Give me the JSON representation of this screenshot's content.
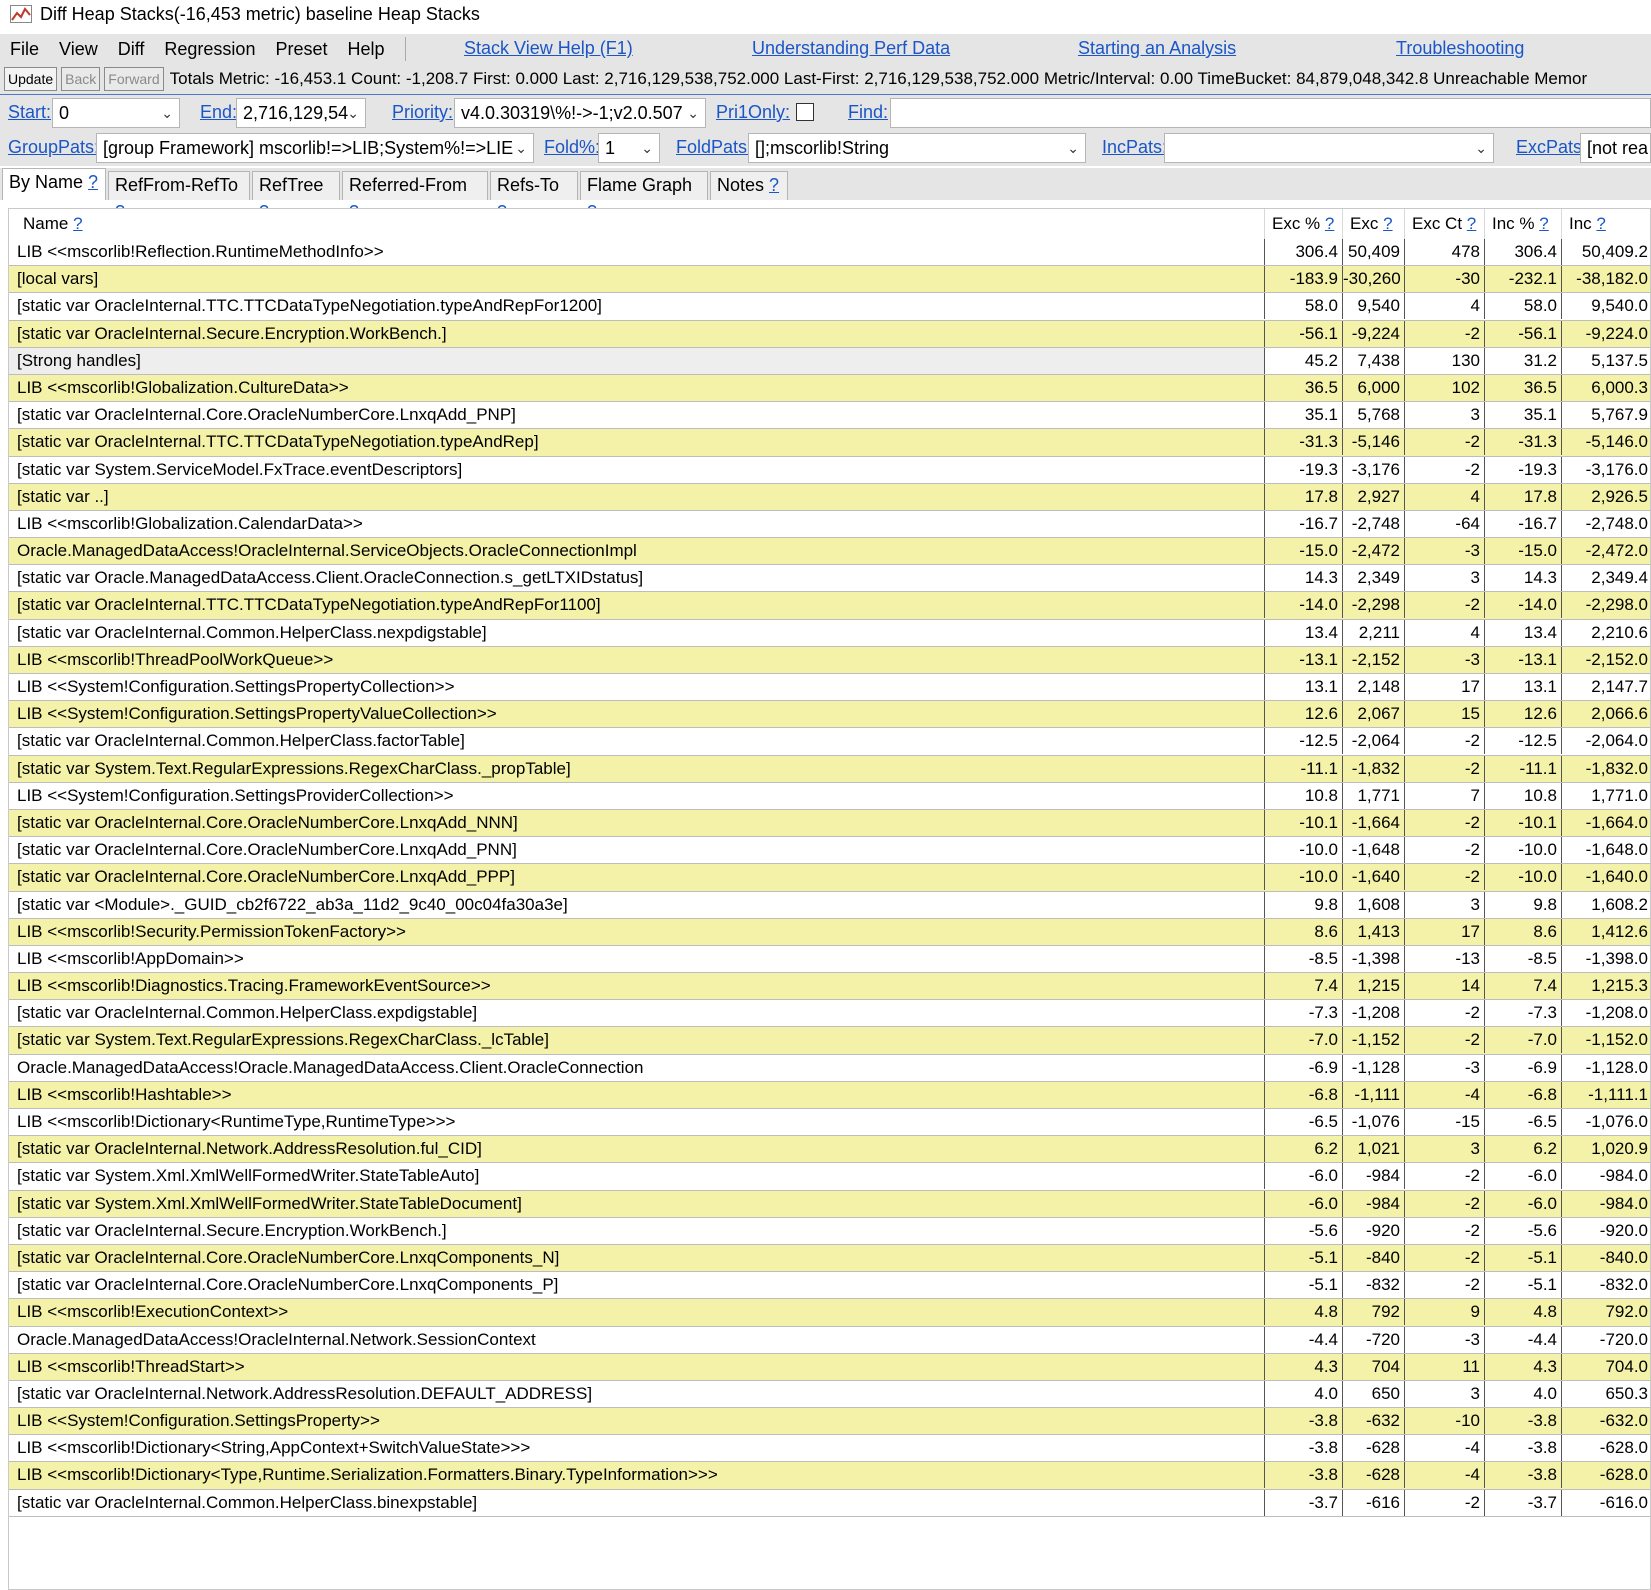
{
  "window": {
    "title": "Diff Heap Stacks(-16,453 metric) baseline Heap Stacks"
  },
  "menu": [
    "File",
    "View",
    "Diff",
    "Regression",
    "Preset",
    "Help"
  ],
  "help_links": [
    "Stack View Help (F1)",
    "Understanding Perf Data",
    "Starting an Analysis",
    "Troubleshooting"
  ],
  "toolbar": {
    "update_label": "Update",
    "back_label": "Back",
    "forward_label": "Forward",
    "totals_text": "Totals Metric: -16,453.1  Count: -1,208.7  First: 0.000 Last: 2,716,129,538,752.000  Last-First: 2,716,129,538,752.000  Metric/Interval: 0.00  TimeBucket: 84,879,048,342.8  Unreachable Memor"
  },
  "filters": {
    "start_label": "Start:",
    "start_value": "0",
    "end_label": "End:",
    "end_value": "2,716,129,54",
    "priority_label": "Priority:",
    "priority_value": "v4.0.30319\\%!->-1;v2.0.507",
    "pri1only_label": "Pri1Only:",
    "find_label": "Find:",
    "find_value": "",
    "grouppats_label": "GroupPats:",
    "grouppats_value": "[group Framework] mscorlib!=>LIB;System%!=>LIE",
    "fold_label": "Fold%:",
    "fold_value": "1",
    "foldpats_label": "FoldPats:",
    "foldpats_value": "[];mscorlib!String",
    "incpats_label": "IncPats:",
    "incpats_value": "",
    "excpats_label": "ExcPats:",
    "excpats_value": "[not rea"
  },
  "tabs": [
    "By Name",
    "RefFrom-RefTo",
    "RefTree",
    "Referred-From",
    "Refs-To",
    "Flame Graph",
    "Notes"
  ],
  "tab_help": "?",
  "columns": [
    "Name",
    "Exc %",
    "Exc",
    "Exc Ct",
    "Inc %",
    "Inc"
  ],
  "rows": [
    [
      "LIB <<mscorlib!Reflection.RuntimeMethodInfo>>",
      "306.4",
      "50,409",
      "478",
      "306.4",
      "50,409.2"
    ],
    [
      "[local vars]",
      "-183.9",
      "-30,260",
      "-30",
      "-232.1",
      "-38,182.0"
    ],
    [
      "[static var OracleInternal.TTC.TTCDataTypeNegotiation.typeAndRepFor1200]",
      "58.0",
      "9,540",
      "4",
      "58.0",
      "9,540.0"
    ],
    [
      "[static var OracleInternal.Secure.Encryption.WorkBench.]",
      "-56.1",
      "-9,224",
      "-2",
      "-56.1",
      "-9,224.0"
    ],
    [
      "[Strong handles]",
      "45.2",
      "7,438",
      "130",
      "31.2",
      "5,137.5"
    ],
    [
      "LIB <<mscorlib!Globalization.CultureData>>",
      "36.5",
      "6,000",
      "102",
      "36.5",
      "6,000.3"
    ],
    [
      "[static var OracleInternal.Core.OracleNumberCore.LnxqAdd_PNP]",
      "35.1",
      "5,768",
      "3",
      "35.1",
      "5,767.9"
    ],
    [
      "[static var OracleInternal.TTC.TTCDataTypeNegotiation.typeAndRep]",
      "-31.3",
      "-5,146",
      "-2",
      "-31.3",
      "-5,146.0"
    ],
    [
      "[static var System.ServiceModel.FxTrace.eventDescriptors]",
      "-19.3",
      "-3,176",
      "-2",
      "-19.3",
      "-3,176.0"
    ],
    [
      "[static var ..]",
      "17.8",
      "2,927",
      "4",
      "17.8",
      "2,926.5"
    ],
    [
      "LIB <<mscorlib!Globalization.CalendarData>>",
      "-16.7",
      "-2,748",
      "-64",
      "-16.7",
      "-2,748.0"
    ],
    [
      "Oracle.ManagedDataAccess!OracleInternal.ServiceObjects.OracleConnectionImpl",
      "-15.0",
      "-2,472",
      "-3",
      "-15.0",
      "-2,472.0"
    ],
    [
      "[static var Oracle.ManagedDataAccess.Client.OracleConnection.s_getLTXIDstatus]",
      "14.3",
      "2,349",
      "3",
      "14.3",
      "2,349.4"
    ],
    [
      "[static var OracleInternal.TTC.TTCDataTypeNegotiation.typeAndRepFor1100]",
      "-14.0",
      "-2,298",
      "-2",
      "-14.0",
      "-2,298.0"
    ],
    [
      "[static var OracleInternal.Common.HelperClass.nexpdigstable]",
      "13.4",
      "2,211",
      "4",
      "13.4",
      "2,210.6"
    ],
    [
      "LIB <<mscorlib!ThreadPoolWorkQueue>>",
      "-13.1",
      "-2,152",
      "-3",
      "-13.1",
      "-2,152.0"
    ],
    [
      "LIB <<System!Configuration.SettingsPropertyCollection>>",
      "13.1",
      "2,148",
      "17",
      "13.1",
      "2,147.7"
    ],
    [
      "LIB <<System!Configuration.SettingsPropertyValueCollection>>",
      "12.6",
      "2,067",
      "15",
      "12.6",
      "2,066.6"
    ],
    [
      "[static var OracleInternal.Common.HelperClass.factorTable]",
      "-12.5",
      "-2,064",
      "-2",
      "-12.5",
      "-2,064.0"
    ],
    [
      "[static var System.Text.RegularExpressions.RegexCharClass._propTable]",
      "-11.1",
      "-1,832",
      "-2",
      "-11.1",
      "-1,832.0"
    ],
    [
      "LIB <<System!Configuration.SettingsProviderCollection>>",
      "10.8",
      "1,771",
      "7",
      "10.8",
      "1,771.0"
    ],
    [
      "[static var OracleInternal.Core.OracleNumberCore.LnxqAdd_NNN]",
      "-10.1",
      "-1,664",
      "-2",
      "-10.1",
      "-1,664.0"
    ],
    [
      "[static var OracleInternal.Core.OracleNumberCore.LnxqAdd_PNN]",
      "-10.0",
      "-1,648",
      "-2",
      "-10.0",
      "-1,648.0"
    ],
    [
      "[static var OracleInternal.Core.OracleNumberCore.LnxqAdd_PPP]",
      "-10.0",
      "-1,640",
      "-2",
      "-10.0",
      "-1,640.0"
    ],
    [
      "[static var <Module>._GUID_cb2f6722_ab3a_11d2_9c40_00c04fa30a3e]",
      "9.8",
      "1,608",
      "3",
      "9.8",
      "1,608.2"
    ],
    [
      "LIB <<mscorlib!Security.PermissionTokenFactory>>",
      "8.6",
      "1,413",
      "17",
      "8.6",
      "1,412.6"
    ],
    [
      "LIB <<mscorlib!AppDomain>>",
      "-8.5",
      "-1,398",
      "-13",
      "-8.5",
      "-1,398.0"
    ],
    [
      "LIB <<mscorlib!Diagnostics.Tracing.FrameworkEventSource>>",
      "7.4",
      "1,215",
      "14",
      "7.4",
      "1,215.3"
    ],
    [
      "[static var OracleInternal.Common.HelperClass.expdigstable]",
      "-7.3",
      "-1,208",
      "-2",
      "-7.3",
      "-1,208.0"
    ],
    [
      "[static var System.Text.RegularExpressions.RegexCharClass._lcTable]",
      "-7.0",
      "-1,152",
      "-2",
      "-7.0",
      "-1,152.0"
    ],
    [
      "Oracle.ManagedDataAccess!Oracle.ManagedDataAccess.Client.OracleConnection",
      "-6.9",
      "-1,128",
      "-3",
      "-6.9",
      "-1,128.0"
    ],
    [
      "LIB <<mscorlib!Hashtable>>",
      "-6.8",
      "-1,111",
      "-4",
      "-6.8",
      "-1,111.1"
    ],
    [
      "LIB <<mscorlib!Dictionary<RuntimeType,RuntimeType>>>",
      "-6.5",
      "-1,076",
      "-15",
      "-6.5",
      "-1,076.0"
    ],
    [
      "[static var OracleInternal.Network.AddressResolution.ful_CID]",
      "6.2",
      "1,021",
      "3",
      "6.2",
      "1,020.9"
    ],
    [
      "[static var System.Xml.XmlWellFormedWriter.StateTableAuto]",
      "-6.0",
      "-984",
      "-2",
      "-6.0",
      "-984.0"
    ],
    [
      "[static var System.Xml.XmlWellFormedWriter.StateTableDocument]",
      "-6.0",
      "-984",
      "-2",
      "-6.0",
      "-984.0"
    ],
    [
      "[static var OracleInternal.Secure.Encryption.WorkBench.]",
      "-5.6",
      "-920",
      "-2",
      "-5.6",
      "-920.0"
    ],
    [
      "[static var OracleInternal.Core.OracleNumberCore.LnxqComponents_N]",
      "-5.1",
      "-840",
      "-2",
      "-5.1",
      "-840.0"
    ],
    [
      "[static var OracleInternal.Core.OracleNumberCore.LnxqComponents_P]",
      "-5.1",
      "-832",
      "-2",
      "-5.1",
      "-832.0"
    ],
    [
      "LIB <<mscorlib!ExecutionContext>>",
      "4.8",
      "792",
      "9",
      "4.8",
      "792.0"
    ],
    [
      "Oracle.ManagedDataAccess!OracleInternal.Network.SessionContext",
      "-4.4",
      "-720",
      "-3",
      "-4.4",
      "-720.0"
    ],
    [
      "LIB <<mscorlib!ThreadStart>>",
      "4.3",
      "704",
      "11",
      "4.3",
      "704.0"
    ],
    [
      "[static var OracleInternal.Network.AddressResolution.DEFAULT_ADDRESS]",
      "4.0",
      "650",
      "3",
      "4.0",
      "650.3"
    ],
    [
      "LIB <<System!Configuration.SettingsProperty>>",
      "-3.8",
      "-632",
      "-10",
      "-3.8",
      "-632.0"
    ],
    [
      "LIB <<mscorlib!Dictionary<String,AppContext+SwitchValueState>>>",
      "-3.8",
      "-628",
      "-4",
      "-3.8",
      "-628.0"
    ],
    [
      "LIB <<mscorlib!Dictionary<Type,Runtime.Serialization.Formatters.Binary.TypeInformation>>>",
      "-3.8",
      "-628",
      "-4",
      "-3.8",
      "-628.0"
    ],
    [
      "[static var OracleInternal.Common.HelperClass.binexpstable]",
      "-3.7",
      "-616",
      "-2",
      "-3.7",
      "-616.0"
    ]
  ]
}
